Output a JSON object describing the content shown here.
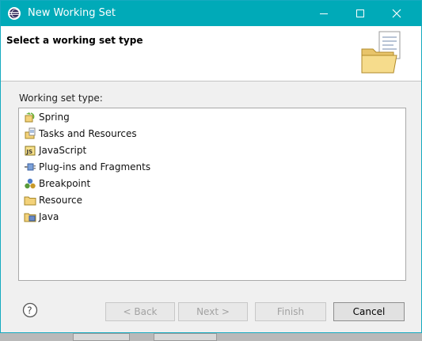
{
  "window": {
    "title": "New Working Set",
    "controls": {
      "minimize_icon": "minimize-icon",
      "maximize_icon": "maximize-icon",
      "close_icon": "close-icon"
    }
  },
  "header": {
    "heading": "Select a working set type",
    "icon": "folder-with-document-icon"
  },
  "content": {
    "list_label": "Working set type:",
    "items": [
      {
        "label": "Spring",
        "icon": "spring-icon"
      },
      {
        "label": "Tasks and Resources",
        "icon": "tasks-resources-icon"
      },
      {
        "label": "JavaScript",
        "icon": "javascript-icon"
      },
      {
        "label": "Plug-ins and Fragments",
        "icon": "plugin-icon"
      },
      {
        "label": "Breakpoint",
        "icon": "breakpoint-icon"
      },
      {
        "label": "Resource",
        "icon": "resource-folder-icon"
      },
      {
        "label": "Java",
        "icon": "java-icon"
      }
    ]
  },
  "footer": {
    "help_icon": "help-icon",
    "back": "< Back",
    "next": "Next >",
    "finish": "Finish",
    "cancel": "Cancel"
  },
  "colors": {
    "titlebar": "#00aab8",
    "border": "#15aabf",
    "dialog_bg": "#f0f0f0"
  }
}
